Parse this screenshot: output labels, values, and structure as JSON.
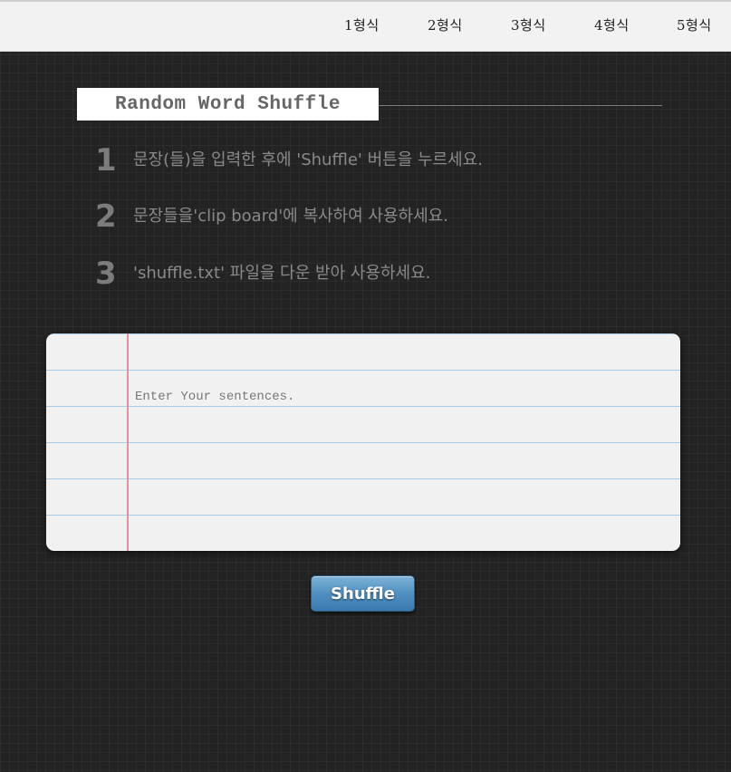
{
  "nav": {
    "items": [
      {
        "label": "1형식"
      },
      {
        "label": "2형식"
      },
      {
        "label": "3형식"
      },
      {
        "label": "4형식"
      },
      {
        "label": "5형식"
      }
    ]
  },
  "header": {
    "title": "Random Word Shuffle"
  },
  "steps": [
    {
      "number": "1",
      "text": "문장(들)을 입력한 후에 'Shuffle' 버튼을 누르세요."
    },
    {
      "number": "2",
      "text": "문장들을'clip board'에 복사하여 사용하세요."
    },
    {
      "number": "3",
      "text": "'shuffle.txt' 파일을 다운 받아 사용하세요."
    }
  ],
  "editor": {
    "placeholder": "Enter Your sentences.",
    "value": ""
  },
  "actions": {
    "shuffle_label": "Shuffle"
  },
  "colors": {
    "background": "#232323",
    "nav_bg": "#f2f2f2",
    "paper_bg": "#f1f1f1",
    "paper_rule": "#a9cbe6",
    "paper_margin": "#e58ea6",
    "button": "#4f8fc0"
  }
}
